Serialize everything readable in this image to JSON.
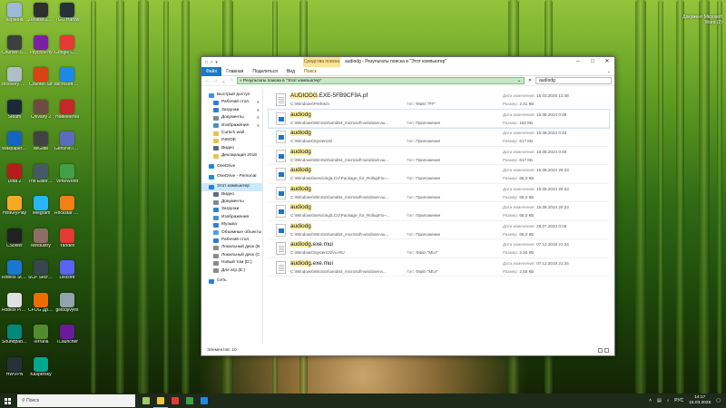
{
  "desktop": {
    "icons": [
      {
        "label": "Корзина",
        "color": "#9bb9d8"
      },
      {
        "label": "Zenless Zone",
        "color": "#2f2f2f"
      },
      {
        "label": "TGO Hardw",
        "color": "#263238"
      },
      {
        "label": "Counter-Str 2",
        "color": "#3e3e3e"
      },
      {
        "label": "PsychoPhy",
        "color": "#7b1fa2"
      },
      {
        "label": "Google Chrome",
        "color": "#e53935"
      },
      {
        "label": "recovery socket",
        "color": "#b0bec5"
      },
      {
        "label": "Counter-Str",
        "color": "#d84315"
      },
      {
        "label": "Microsoft Edge",
        "color": "#1e88e5"
      },
      {
        "label": "Steam",
        "color": "#1b2838"
      },
      {
        "label": "Chivalry 2",
        "color": "#6d4c41"
      },
      {
        "label": "НовиМетка",
        "color": "#c62828"
      },
      {
        "label": "Wallpaper Engine",
        "color": "#1565c0"
      },
      {
        "label": "MiGate",
        "color": "#424242"
      },
      {
        "label": "Genshin Impact",
        "color": "#5c6bc0"
      },
      {
        "label": "Dota 2",
        "color": "#b71c1c"
      },
      {
        "label": "The Elder Scrolls",
        "color": "#455a64"
      },
      {
        "label": "VimeWorld",
        "color": "#43a047"
      },
      {
        "label": "HotKeyPlay",
        "color": "#f9a825"
      },
      {
        "label": "Telegram",
        "color": "#29b6f6"
      },
      {
        "label": "Rockstar Games",
        "color": "#f57f17"
      },
      {
        "label": "CSolver",
        "color": "#212121"
      },
      {
        "label": "Mindustry",
        "color": "#8d6e63"
      },
      {
        "label": "Yandex",
        "color": "#e53935"
      },
      {
        "label": "Roblox Studio",
        "color": "#1976d2"
      },
      {
        "label": "SCP Secret Laboratory",
        "color": "#37474f"
      },
      {
        "label": "Discord",
        "color": "#5865f2"
      },
      {
        "label": "Roblox Player",
        "color": "#e0e0e0"
      },
      {
        "label": "CFOG Дрема 5X",
        "color": "#ef6c00"
      },
      {
        "label": "getobjivyes",
        "color": "#90a4ae"
      },
      {
        "label": "Soundpad Demo",
        "color": "#00897b"
      },
      {
        "label": "Terraria",
        "color": "#558b2f"
      },
      {
        "label": "TLauncher",
        "color": "#6a1b9a"
      },
      {
        "label": "HWVPN",
        "color": "#263238"
      },
      {
        "label": "Kaspersky",
        "color": "#00a88e"
      }
    ],
    "top_right_text": "Документ Microsoft Word (2)"
  },
  "explorer": {
    "title": "audiodg - Результаты поиска в \"Этот компьютер\"",
    "context_tab": "Средства поиска",
    "ribbon_tabs": [
      "Файл",
      "Главная",
      "Поделиться",
      "Вид",
      "Поиск"
    ],
    "address": "Результаты поиска в \"Этот компьютер\"",
    "search_value": "audiodg",
    "nav_items": [
      {
        "label": "Быстрый доступ",
        "level": 1,
        "color": "#3d8fe0",
        "pin": false,
        "gap": false,
        "selected": false
      },
      {
        "label": "Рабочий стол",
        "level": 2,
        "color": "#2d7fd3",
        "pin": true,
        "gap": false,
        "selected": false
      },
      {
        "label": "Загрузки",
        "level": 2,
        "color": "#2d7fd3",
        "pin": true,
        "gap": false,
        "selected": false
      },
      {
        "label": "Документы",
        "level": 2,
        "color": "#7a8a99",
        "pin": true,
        "gap": false,
        "selected": false
      },
      {
        "label": "Изображения",
        "level": 2,
        "color": "#4a90c8",
        "pin": true,
        "gap": false,
        "selected": false
      },
      {
        "label": "Curta'n wall",
        "level": 2,
        "color": "#e8c14a",
        "pin": false,
        "gap": false,
        "selected": false
      },
      {
        "label": "INSIDE",
        "level": 2,
        "color": "#e8c14a",
        "pin": false,
        "gap": false,
        "selected": false
      },
      {
        "label": "Видео",
        "level": 2,
        "color": "#5b6b7a",
        "pin": false,
        "gap": false,
        "selected": false
      },
      {
        "label": "Декларация 2018",
        "level": 2,
        "color": "#e8c14a",
        "pin": false,
        "gap": false,
        "selected": false
      },
      {
        "label": "OneDrive",
        "level": 1,
        "color": "#1e88e5",
        "pin": false,
        "gap": true,
        "selected": false
      },
      {
        "label": "OneDrive - Personal",
        "level": 1,
        "color": "#1e88e5",
        "pin": false,
        "gap": true,
        "selected": false
      },
      {
        "label": "Этот компьютер",
        "level": 1,
        "color": "#2d7fd3",
        "pin": false,
        "gap": true,
        "selected": true
      },
      {
        "label": "Видео",
        "level": 2,
        "color": "#5b6b7a",
        "pin": false,
        "gap": false,
        "selected": false
      },
      {
        "label": "Документы",
        "level": 2,
        "color": "#7a8a99",
        "pin": false,
        "gap": false,
        "selected": false
      },
      {
        "label": "Загрузки",
        "level": 2,
        "color": "#2d7fd3",
        "pin": false,
        "gap": false,
        "selected": false
      },
      {
        "label": "Изображения",
        "level": 2,
        "color": "#4a90c8",
        "pin": false,
        "gap": false,
        "selected": false
      },
      {
        "label": "Музыка",
        "level": 2,
        "color": "#3a7bd5",
        "pin": false,
        "gap": false,
        "selected": false
      },
      {
        "label": "Объемные объекты",
        "level": 2,
        "color": "#56a0d8",
        "pin": false,
        "gap": false,
        "selected": false
      },
      {
        "label": "Рабочий стол",
        "level": 2,
        "color": "#2d7fd3",
        "pin": false,
        "gap": false,
        "selected": false
      },
      {
        "label": "Локальный диск (B",
        "level": 2,
        "color": "#8a8a8a",
        "pin": false,
        "gap": false,
        "selected": false
      },
      {
        "label": "Локальный диск (C",
        "level": 2,
        "color": "#8a8a8a",
        "pin": false,
        "gap": false,
        "selected": false
      },
      {
        "label": "Новый том (D:)",
        "level": 2,
        "color": "#8a8a8a",
        "pin": false,
        "gap": false,
        "selected": false
      },
      {
        "label": "Для игр (E:)",
        "level": 2,
        "color": "#8a8a8a",
        "pin": false,
        "gap": false,
        "selected": false
      },
      {
        "label": "Сеть",
        "level": 1,
        "color": "#2d7fd3",
        "pin": false,
        "gap": true,
        "selected": false
      }
    ],
    "results": [
      {
        "name": "AUDIODG.EXE-5FB9CF9A.pf",
        "match": "AUDIODG",
        "rest": ".EXE-5FB9CF9A.pf",
        "path": "C:\\Windows\\Prefetch",
        "type_label": "Тип:",
        "type": "Файл \"PF\"",
        "date_label": "Дата изменения:",
        "date": "15.03.2025 13:48",
        "size_label": "Размер:",
        "size": "2,41 КБ",
        "icon": "doc"
      },
      {
        "name": "audiodg",
        "match": "audiodg",
        "rest": "",
        "path": "C:\\Windows\\WinSxS\\amd64_microsoft-windows-au...",
        "type_label": "Тип:",
        "type": "Приложение",
        "date_label": "Дата изменения:",
        "date": "16.08.2024 0:48",
        "size_label": "Размер:",
        "size": "162 КБ",
        "icon": "exe"
      },
      {
        "name": "audiodg",
        "match": "audiodg",
        "rest": "",
        "path": "C:\\Windows\\System32",
        "type_label": "Тип:",
        "type": "Приложение",
        "date_label": "Дата изменения:",
        "date": "16.08.2024 0:48",
        "size_label": "Размер:",
        "size": "617 КБ",
        "icon": "exe"
      },
      {
        "name": "audiodg",
        "match": "audiodg",
        "rest": "",
        "path": "C:\\Windows\\WinSxS\\amd64_microsoft-windows-au...",
        "type_label": "Тип:",
        "type": "Приложение",
        "date_label": "Дата изменения:",
        "date": "16.08.2024 0:48",
        "size_label": "Размер:",
        "size": "617 КБ",
        "icon": "exe"
      },
      {
        "name": "audiodg",
        "match": "audiodg",
        "rest": "",
        "path": "C:\\Windows\\servicing\\LCU\\Package_for_RollupFix~...",
        "type_label": "Тип:",
        "type": "Приложение",
        "date_label": "Дата изменения:",
        "date": "15.08.2024 20:23",
        "size_label": "Размер:",
        "size": "65,0 КБ",
        "icon": "exe"
      },
      {
        "name": "audiodg",
        "match": "audiodg",
        "rest": "",
        "path": "C:\\Windows\\WinSxS\\amd64_microsoft-windows-au...",
        "type_label": "Тип:",
        "type": "Приложение",
        "date_label": "Дата изменения:",
        "date": "15.08.2024 20:23",
        "size_label": "Размер:",
        "size": "65,0 КБ",
        "icon": "exe"
      },
      {
        "name": "audiodg",
        "match": "audiodg",
        "rest": "",
        "path": "C:\\Windows\\servicing\\LCU\\Package_for_RollupFix~...",
        "type_label": "Тип:",
        "type": "Приложение",
        "date_label": "Дата изменения:",
        "date": "15.08.2024 20:23",
        "size_label": "Размер:",
        "size": "65,0 КБ",
        "icon": "exe"
      },
      {
        "name": "audiodg",
        "match": "audiodg",
        "rest": "",
        "path": "C:\\Windows\\WinSxS\\amd64_microsoft-windows-au...",
        "type_label": "Тип:",
        "type": "Приложение",
        "date_label": "Дата изменения:",
        "date": "28.07.2024 0:25",
        "size_label": "Размер:",
        "size": "65,0 КБ",
        "icon": "exe"
      },
      {
        "name": "audiodg.exe.mui",
        "match": "audiodg",
        "rest": ".exe.mui",
        "path": "C:\\Windows\\System32\\ru-RU",
        "type_label": "Тип:",
        "type": "Файл \"MUI\"",
        "date_label": "Дата изменения:",
        "date": "07.12.2019 21:34",
        "size_label": "Размер:",
        "size": "2,50 КБ",
        "icon": "doc"
      },
      {
        "name": "audiodg.exe.mui",
        "match": "audiodg",
        "rest": ".exe.mui",
        "path": "C:\\Windows\\WinSxS\\amd64_microsoft-windows-a...",
        "type_label": "Тип:",
        "type": "Файл \"MUI\"",
        "date_label": "Дата изменения:",
        "date": "07.12.2019 21:34",
        "size_label": "Размер:",
        "size": "2,50 КБ",
        "icon": "doc"
      }
    ],
    "status": "Элементов: 10"
  },
  "taskbar": {
    "search_placeholder": "Поиск",
    "apps": [
      {
        "name": "taskbar-app-town",
        "color": "#9ccc65"
      },
      {
        "name": "taskbar-app-explorer",
        "color": "#f4c542"
      },
      {
        "name": "taskbar-app-yandex",
        "color": "#e53935"
      },
      {
        "name": "taskbar-app-xbox",
        "color": "#43a047"
      },
      {
        "name": "taskbar-app-vscode",
        "color": "#1e88e5"
      }
    ],
    "lang": "РУС",
    "time": "14:17",
    "date": "15.03.2025"
  }
}
